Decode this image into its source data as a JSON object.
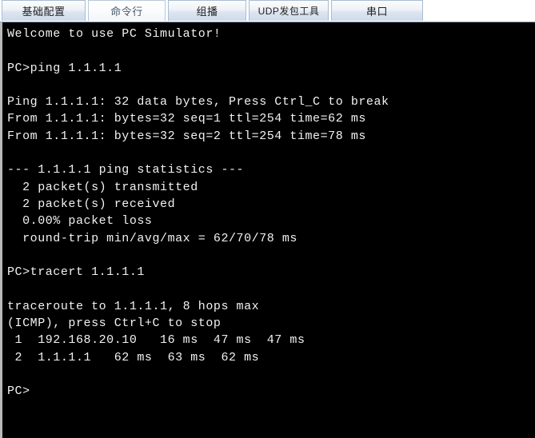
{
  "window": {
    "background": "#ffffff",
    "terminal_bg": "#000000",
    "terminal_fg": "#f2f2f2"
  },
  "tabs": {
    "items": [
      {
        "label": "基础配置",
        "name": "tab-basic-config",
        "active": false
      },
      {
        "label": "命令行",
        "name": "tab-command-line",
        "active": true
      },
      {
        "label": "组播",
        "name": "tab-multicast",
        "active": false
      },
      {
        "label": "UDP发包工具",
        "name": "tab-udp-packet-tool",
        "active": false
      },
      {
        "label": "串口",
        "name": "tab-serial-port",
        "active": false
      }
    ]
  },
  "terminal": {
    "prompt": "PC>",
    "lines": [
      "Welcome to use PC Simulator!",
      "",
      "PC>ping 1.1.1.1",
      "",
      "Ping 1.1.1.1: 32 data bytes, Press Ctrl_C to break",
      "From 1.1.1.1: bytes=32 seq=1 ttl=254 time=62 ms",
      "From 1.1.1.1: bytes=32 seq=2 ttl=254 time=78 ms",
      "",
      "--- 1.1.1.1 ping statistics ---",
      "  2 packet(s) transmitted",
      "  2 packet(s) received",
      "  0.00% packet loss",
      "  round-trip min/avg/max = 62/70/78 ms",
      "",
      "PC>tracert 1.1.1.1",
      "",
      "traceroute to 1.1.1.1, 8 hops max",
      "(ICMP), press Ctrl+C to stop",
      " 1  192.168.20.10   16 ms  47 ms  47 ms",
      " 2  1.1.1.1   62 ms  63 ms  62 ms",
      "",
      "PC>"
    ],
    "ping": {
      "command": "ping 1.1.1.1",
      "target": "1.1.1.1",
      "data_bytes": 32,
      "break_key": "Ctrl_C",
      "replies": [
        {
          "from": "1.1.1.1",
          "bytes": 32,
          "seq": 1,
          "ttl": 254,
          "time_ms": 62
        },
        {
          "from": "1.1.1.1",
          "bytes": 32,
          "seq": 2,
          "ttl": 254,
          "time_ms": 78
        }
      ],
      "statistics": {
        "transmitted": 2,
        "received": 2,
        "packet_loss": "0.00%",
        "min_ms": 62,
        "avg_ms": 70,
        "max_ms": 78
      }
    },
    "tracert": {
      "command": "tracert 1.1.1.1",
      "target": "1.1.1.1",
      "max_hops": 8,
      "protocol": "ICMP",
      "stop_key": "Ctrl+C",
      "hops": [
        {
          "hop": 1,
          "address": "192.168.20.10",
          "times_ms": [
            16,
            47,
            47
          ]
        },
        {
          "hop": 2,
          "address": "1.1.1.1",
          "times_ms": [
            62,
            63,
            62
          ]
        }
      ]
    }
  }
}
